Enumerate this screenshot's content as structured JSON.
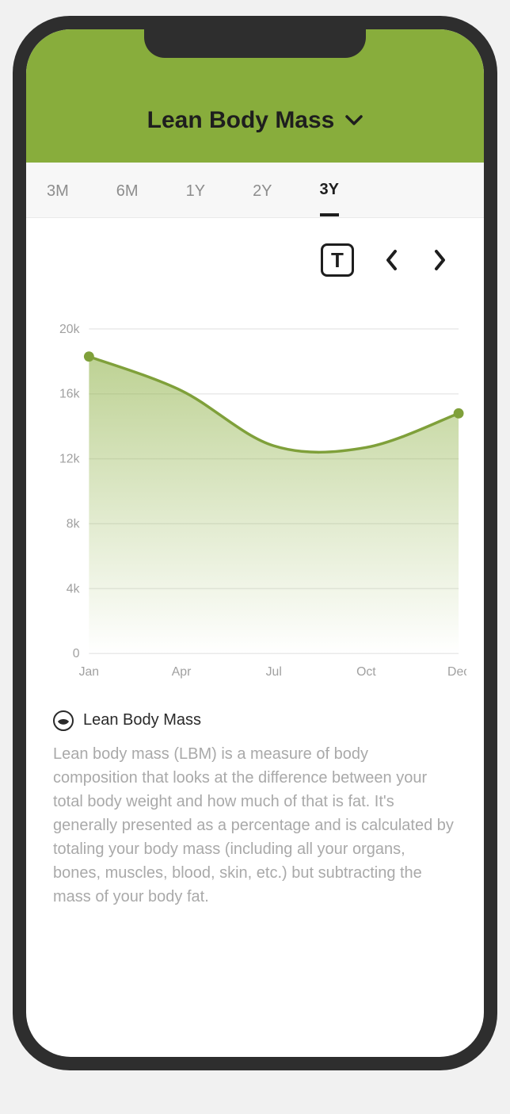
{
  "header": {
    "title": "Lean Body Mass"
  },
  "tabs": {
    "items": [
      {
        "label": "3M",
        "active": false
      },
      {
        "label": "6M",
        "active": false
      },
      {
        "label": "1Y",
        "active": false
      },
      {
        "label": "2Y",
        "active": false
      },
      {
        "label": "3Y",
        "active": true
      }
    ]
  },
  "toolbar": {
    "t_label": "T"
  },
  "info": {
    "title": "Lean Body Mass",
    "body": "Lean body mass (LBM) is a measure of body composition that looks at the difference between your total body weight and how much of that is fat. It's generally presented as a percentage and is calculated by totaling your body mass (including all your organs, bones, muscles, blood, skin, etc.) but subtracting the mass of your body fat."
  },
  "colors": {
    "accent": "#88ad3c",
    "line": "#7fa03a",
    "grid": "#eaeaea",
    "text_muted": "#a9a9a9"
  },
  "chart_data": {
    "type": "area",
    "title": "",
    "xlabel": "",
    "ylabel": "",
    "ylim": [
      0,
      20000
    ],
    "y_ticks": [
      "20k",
      "16k",
      "12k",
      "8k",
      "4k",
      "0"
    ],
    "x_ticks": [
      "Jan",
      "Apr",
      "Jul",
      "Oct",
      "Dec"
    ],
    "x": [
      "Jan",
      "Apr",
      "Jul",
      "Oct",
      "Dec"
    ],
    "values": [
      18300,
      16200,
      12800,
      12700,
      14800
    ],
    "markers": [
      {
        "x": "Jan",
        "y": 18300
      },
      {
        "x": "Dec",
        "y": 14800
      }
    ]
  }
}
